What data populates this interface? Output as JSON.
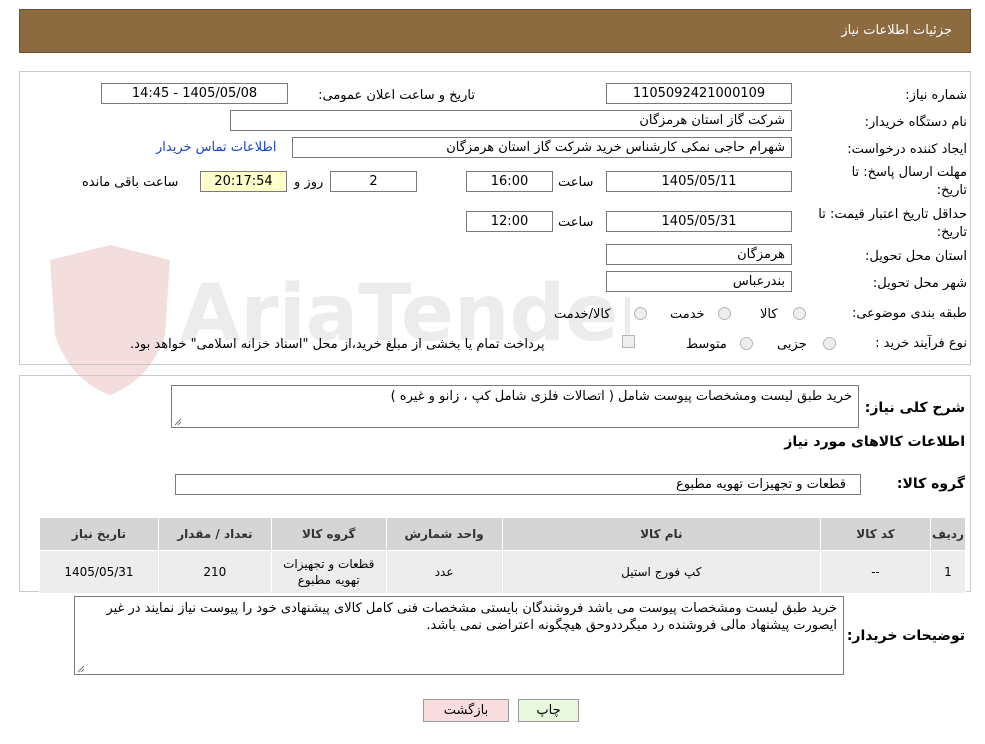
{
  "header": {
    "title": "جزئیات اطلاعات نیاز"
  },
  "labels": {
    "need_number": "شماره نیاز:",
    "announce_datetime": "تاریخ و ساعت اعلان عمومی:",
    "buyer_org": "نام دستگاه خریدار:",
    "creator": "ایجاد کننده درخواست:",
    "deadline": "مهلت ارسال پاسخ: تا",
    "deadline_2": "تاریخ:",
    "validity": "حداقل تاریخ اعتبار قیمت: تا",
    "validity_2": "تاریخ:",
    "hour": "ساعت",
    "hour2": "ساعت",
    "day_and": "روز و",
    "remaining": "ساعت باقی مانده",
    "province": "استان محل تحویل:",
    "city": "شهر محل تحویل:",
    "category": "طبقه بندی موضوعی:",
    "process_type": "نوع فرآیند خرید :"
  },
  "values": {
    "need_number": "1105092421000109",
    "announce_datetime": "1405/05/08 - 14:45",
    "buyer_org": "شرکت گاز استان هرمزگان",
    "creator": "شهرام حاجی نمکی کارشناس خرید شرکت گاز استان هرمزگان",
    "contact_link": "اطلاعات تماس خریدار",
    "deadline_date": "1405/05/11",
    "deadline_time": "16:00",
    "days": "2",
    "remaining_time": "20:17:54",
    "validity_date": "1405/05/31",
    "validity_time": "12:00",
    "province": "هرمزگان",
    "city": "بندرعباس"
  },
  "category_options": [
    "کالا",
    "خدمت",
    "کالا/خدمت"
  ],
  "process_options": [
    "جزیی",
    "متوسط"
  ],
  "payment_note": "پرداخت تمام یا بخشی از مبلغ خرید،از محل \"اسناد خزانه اسلامی\" خواهد بود.",
  "description": {
    "label": "شرح کلی نیاز:",
    "value": "خرید طبق لیست ومشخصات پیوست شامل ( اتصالات فلزی شامل کپ ، زانو و غیره )"
  },
  "goods_section": {
    "title": "اطلاعات کالاهای مورد نیاز"
  },
  "goods_group": {
    "label": "گروه کالا:",
    "value": "قطعات و تجهیزات تهویه مطبوع"
  },
  "table": {
    "headers": [
      "ردیف",
      "کد کالا",
      "نام کالا",
      "واحد شمارش",
      "گروه کالا",
      "تعداد / مقدار",
      "تاریخ نیاز"
    ],
    "rows": [
      [
        "1",
        "--",
        "کپ فورج استیل",
        "عدد",
        "قطعات و تجهیزات تهویه مطبوع",
        "210",
        "1405/05/31"
      ]
    ]
  },
  "buyer_notes": {
    "label": "توضیحات خریدار:",
    "value": "خرید طبق لیست ومشخصات پیوست می باشد فروشندگان بایستی مشخصات فنی کامل کالای پیشنهادی خود را پیوست نیاز نمایند در غیر ایصورت پیشنهاد مالی فروشنده رد میگرددوحق هیچگونه اعتراضی نمی باشد."
  },
  "buttons": {
    "print": "چاپ",
    "back": "بازگشت"
  },
  "watermark": {
    "text": "AriaTender.neT"
  },
  "colors": {
    "header_bg": "#8c6b40",
    "link": "#1a45c0",
    "print_btn": "#e8f8df",
    "back_btn": "#fadede"
  }
}
